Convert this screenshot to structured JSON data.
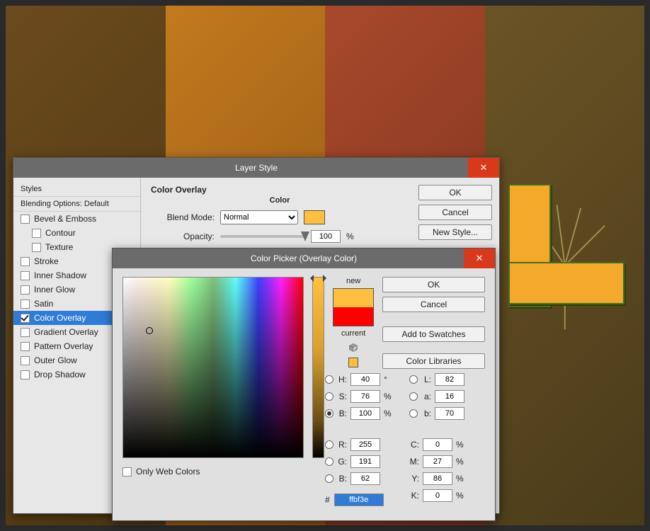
{
  "layerStyle": {
    "title": "Layer Style",
    "stylesHeader": "Styles",
    "blendingHeader": "Blending Options: Default",
    "items": [
      {
        "label": "Bevel & Emboss",
        "checked": false,
        "sub": false
      },
      {
        "label": "Contour",
        "checked": false,
        "sub": true
      },
      {
        "label": "Texture",
        "checked": false,
        "sub": true
      },
      {
        "label": "Stroke",
        "checked": false,
        "sub": false
      },
      {
        "label": "Inner Shadow",
        "checked": false,
        "sub": false
      },
      {
        "label": "Inner Glow",
        "checked": false,
        "sub": false
      },
      {
        "label": "Satin",
        "checked": false,
        "sub": false
      },
      {
        "label": "Color Overlay",
        "checked": true,
        "sub": false,
        "active": true
      },
      {
        "label": "Gradient Overlay",
        "checked": false,
        "sub": false
      },
      {
        "label": "Pattern Overlay",
        "checked": false,
        "sub": false
      },
      {
        "label": "Outer Glow",
        "checked": false,
        "sub": false
      },
      {
        "label": "Drop Shadow",
        "checked": false,
        "sub": false
      }
    ],
    "sectionTitle": "Color Overlay",
    "subTitle": "Color",
    "blendModeLabel": "Blend Mode:",
    "blendModeValue": "Normal",
    "opacityLabel": "Opacity:",
    "opacityValue": "100",
    "opacityUnit": "%",
    "swatchColor": "#ffbf3e",
    "buttons": {
      "ok": "OK",
      "cancel": "Cancel",
      "newStyle": "New Style..."
    }
  },
  "colorPicker": {
    "title": "Color Picker (Overlay Color)",
    "newLabel": "new",
    "currentLabel": "current",
    "newColor": "#ffbf3e",
    "currentColor": "#ff0000",
    "buttons": {
      "ok": "OK",
      "cancel": "Cancel",
      "addSwatches": "Add to Swatches",
      "colorLibs": "Color Libraries"
    },
    "hsb": {
      "H": "40",
      "S": "76",
      "B": "100",
      "deg": "°",
      "pct": "%"
    },
    "lab": {
      "L": "82",
      "a": "16",
      "b": "70"
    },
    "rgb": {
      "R": "255",
      "G": "191",
      "B": "62"
    },
    "cmyk": {
      "C": "0",
      "M": "27",
      "Y": "86",
      "K": "0",
      "pct": "%"
    },
    "hexLabel": "#",
    "hexValue": "ffbf3e",
    "onlyWeb": "Only Web Colors",
    "selectedModel": "B"
  }
}
